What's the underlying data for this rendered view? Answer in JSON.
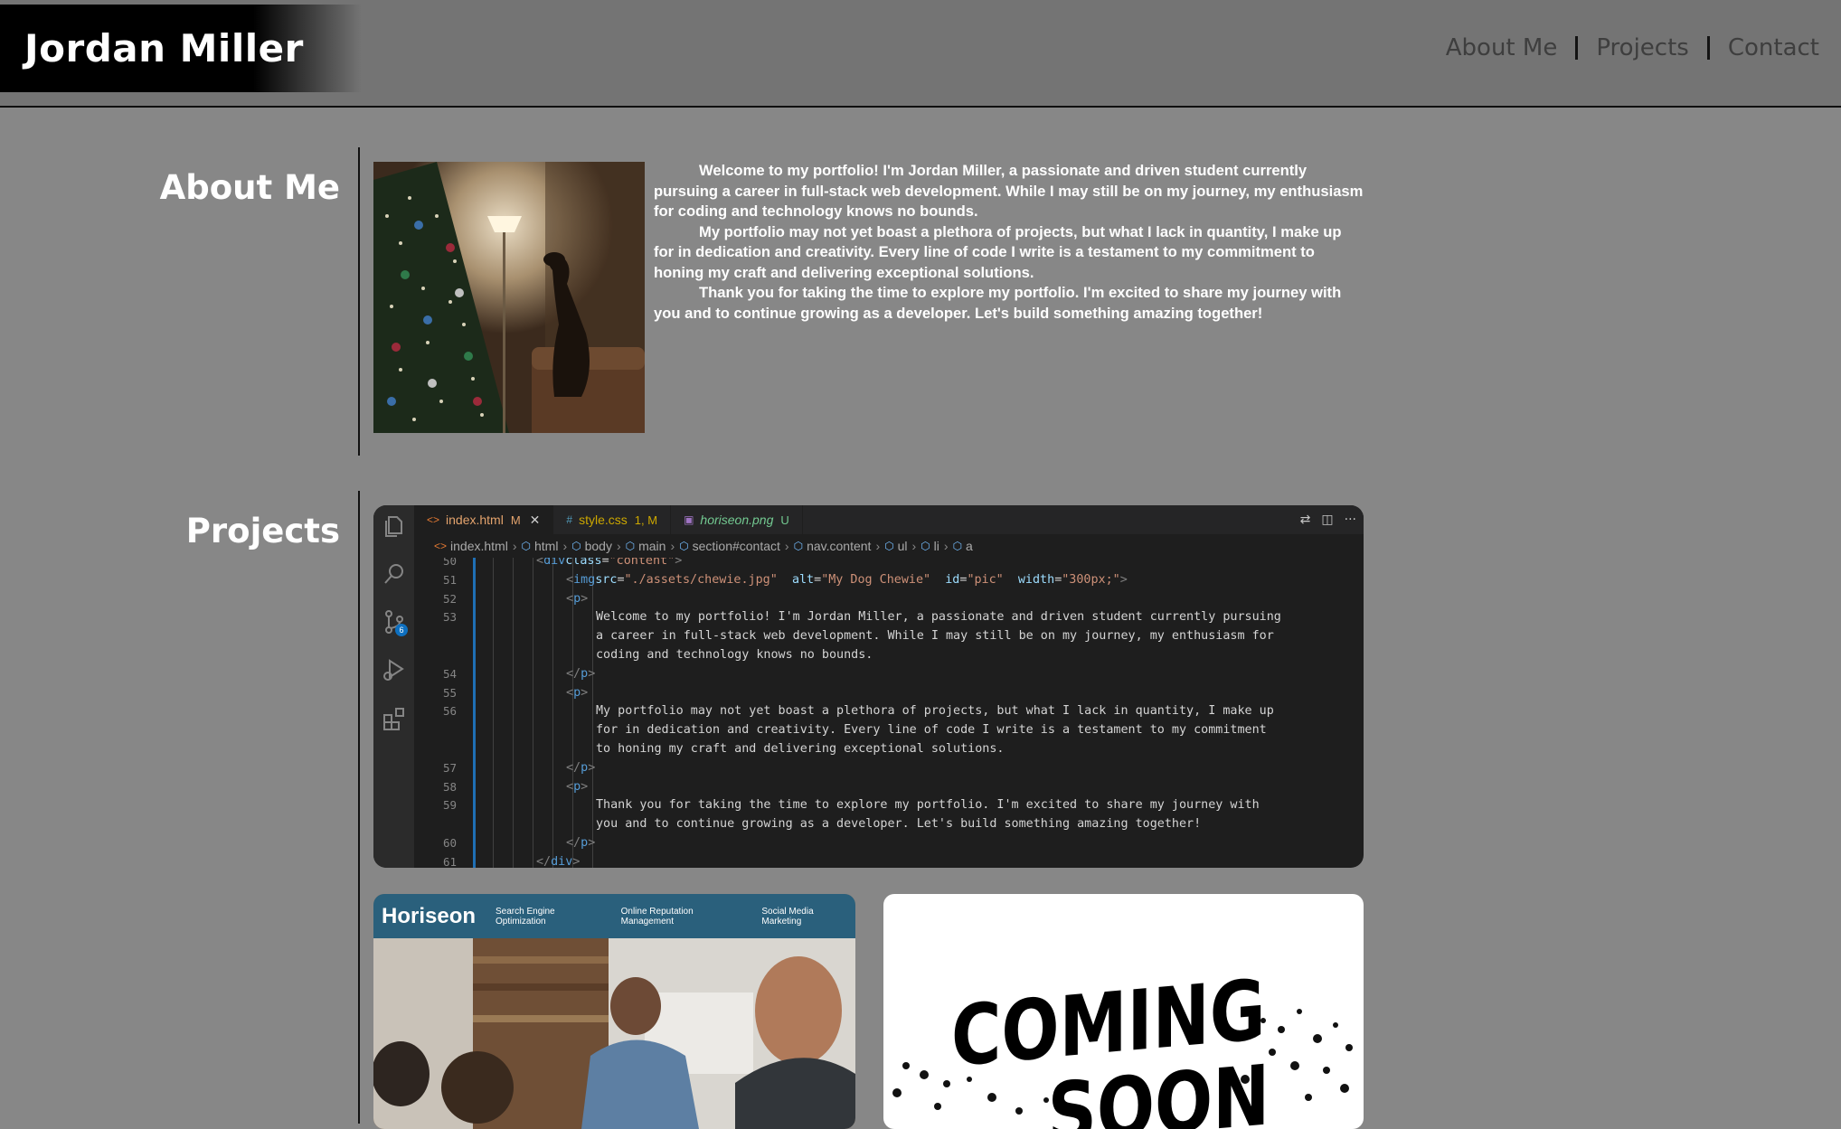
{
  "header": {
    "title": "Jordan Miller",
    "nav": [
      "About Me",
      "Projects",
      "Contact"
    ]
  },
  "about": {
    "heading": "About Me",
    "photo_alt": "My Dog Chewie",
    "paragraphs": [
      "Welcome to my portfolio! I'm Jordan Miller, a passionate and driven student currently pursuing a career in full-stack web development. While I may still be on my journey, my enthusiasm for coding and technology knows no bounds.",
      "My portfolio may not yet boast a plethora of projects, but what I lack in quantity, I make up for in dedication and creativity. Every line of code I write is a testament to my commitment to honing my craft and delivering exceptional solutions.",
      "Thank you for taking the time to explore my portfolio. I'm excited to share my journey with you and to continue growing as a developer. Let's build something amazing together!"
    ]
  },
  "projects": {
    "heading": "Projects",
    "code_screenshot": {
      "tabs": [
        {
          "name": "index.html",
          "status": "M",
          "icon": "html-file-icon",
          "color": "#e37933"
        },
        {
          "name": "style.css",
          "status": "1, M",
          "icon": "css-file-icon",
          "color": "#cca700"
        },
        {
          "name": "horiseon.png",
          "status": "U",
          "icon": "image-file-icon",
          "color": "#73c991"
        }
      ],
      "breadcrumbs": [
        "index.html",
        "html",
        "body",
        "main",
        "section#contact",
        "nav.content",
        "ul",
        "li",
        "a"
      ],
      "scm_badge": "6",
      "lines": [
        {
          "n": "50",
          "code": "<div class=\"content\">"
        },
        {
          "n": "51",
          "code": "<img src=\"./assets/chewie.jpg\" alt=\"My Dog Chewie\" id=\"pic\" width=\"300px;\">"
        },
        {
          "n": "52",
          "code": "<p>"
        },
        {
          "n": "53",
          "code": "Welcome to my portfolio! I'm Jordan Miller, a passionate and driven student currently pursuing"
        },
        {
          "n": "",
          "code": "a career in full-stack web development. While I may still be on my journey, my enthusiasm for"
        },
        {
          "n": "",
          "code": "coding and technology knows no bounds."
        },
        {
          "n": "54",
          "code": "</p>"
        },
        {
          "n": "55",
          "code": "<p>"
        },
        {
          "n": "56",
          "code": "My portfolio may not yet boast a plethora of projects, but what I lack in quantity, I make up"
        },
        {
          "n": "",
          "code": "for in dedication and creativity. Every line of code I write is a testament to my commitment"
        },
        {
          "n": "",
          "code": "to honing my craft and delivering exceptional solutions."
        },
        {
          "n": "57",
          "code": "</p>"
        },
        {
          "n": "58",
          "code": "<p>"
        },
        {
          "n": "59",
          "code": "Thank you for taking the time to explore my portfolio. I'm excited to share my journey with"
        },
        {
          "n": "",
          "code": "you and to continue growing as a developer. Let's build something amazing together!"
        },
        {
          "n": "60",
          "code": "</p>"
        },
        {
          "n": "61",
          "code": "</div>"
        }
      ]
    },
    "horiseon": {
      "logo": "Horiseon",
      "nav": [
        "Search Engine Optimization",
        "Online Reputation Management",
        "Social Media Marketing"
      ]
    },
    "coming_soon": {
      "line1": "COMING",
      "line2": "SOON"
    }
  }
}
